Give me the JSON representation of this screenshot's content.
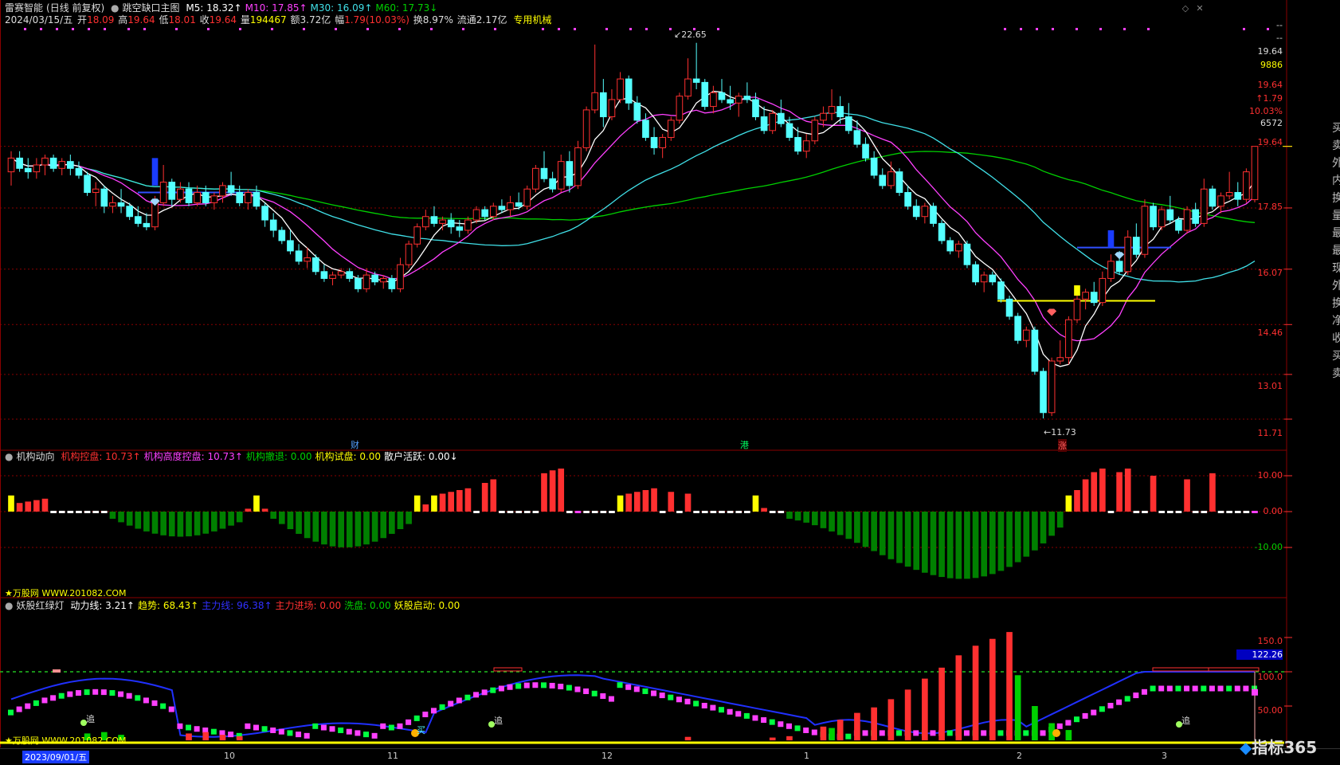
{
  "window": {
    "title": "雷赛智能",
    "period": "(日线 前复权)",
    "indicator": "跳空缺口主图",
    "controls": [
      "◇",
      "✕"
    ]
  },
  "ma_legend": [
    {
      "name": "M5",
      "value": "18.32",
      "arrow": "↑",
      "color": "#ffffff"
    },
    {
      "name": "M10",
      "value": "17.85",
      "arrow": "↑",
      "color": "#ff40ff"
    },
    {
      "name": "M30",
      "value": "16.09",
      "arrow": "↑",
      "color": "#40e0e8"
    },
    {
      "name": "M60",
      "value": "17.73",
      "arrow": "↓",
      "color": "#00d000"
    }
  ],
  "quote": {
    "date": "2024/03/15/五",
    "open_label": "开",
    "open": "18.09",
    "high_label": "高",
    "high": "19.64",
    "low_label": "低",
    "low": "18.01",
    "close_label": "收",
    "close": "19.64",
    "vol_label": "量",
    "vol": "194467",
    "amt_label": "额",
    "amt": "3.72亿",
    "chg_label": "幅",
    "chg": "1.79(10.03%)",
    "turnover_label": "换",
    "turnover": "8.97%",
    "float_label": "流通",
    "float": "2.17亿",
    "sector": "专用机械"
  },
  "price_axis": [
    "19.64",
    "17.85",
    "16.07",
    "14.46",
    "13.01",
    "11.71"
  ],
  "price_annotations": {
    "high": "22.65",
    "low": "11.73"
  },
  "markers": {
    "cai": "财",
    "gang": "港",
    "zhang": "涨",
    "zhui": "追",
    "mai": "买"
  },
  "right_info": {
    "dash1": "--",
    "dash2": "--",
    "price_a": "19.64",
    "vol_a": "9886",
    "price_b": "19.64",
    "chg_up": "↑1.79",
    "chg_pct": "10.03%",
    "vol_b": "6572"
  },
  "right_side_text": [
    "买",
    "卖",
    "外",
    "内",
    "换",
    "量",
    "最",
    "最",
    "现",
    "外",
    "换",
    "净",
    "收",
    "买",
    "卖"
  ],
  "inst_legend": {
    "title": "机构动向",
    "items": [
      {
        "label": "机构控盘:",
        "value": "10.73",
        "arrow": "↑",
        "color": "#ff3030"
      },
      {
        "label": "机构高度控盘:",
        "value": "10.73",
        "arrow": "↑",
        "color": "#ff40ff"
      },
      {
        "label": "机构撤退:",
        "value": "0.00",
        "arrow": "",
        "color": "#00d000"
      },
      {
        "label": "机构试盘:",
        "value": "0.00",
        "arrow": "",
        "color": "#ffff00"
      },
      {
        "label": "散户活跃:",
        "value": "0.00",
        "arrow": "↓",
        "color": "#ffffff"
      }
    ],
    "axis": [
      "10.00",
      "0.00",
      "-10.00"
    ],
    "watermark": "★万股网 WWW.201082.COM"
  },
  "demon_legend": {
    "title": "妖股红绿灯",
    "items": [
      {
        "label": "动力线:",
        "value": "3.21",
        "arrow": "↑",
        "color": "#ffffff"
      },
      {
        "label": "趋势:",
        "value": "68.43",
        "arrow": "↑",
        "color": "#ffff00"
      },
      {
        "label": "主力线:",
        "value": "96.38",
        "arrow": "↑",
        "color": "#3030ff"
      },
      {
        "label": "主力进场:",
        "value": "0.00",
        "arrow": "",
        "color": "#ff3030"
      },
      {
        "label": "洗盘:",
        "value": "0.00",
        "arrow": "",
        "color": "#00d000"
      },
      {
        "label": "妖股启动:",
        "value": "0.00",
        "arrow": "",
        "color": "#ffff00"
      }
    ],
    "axis": [
      "150.0",
      "122.26",
      "100.0",
      "50.00"
    ],
    "watermark": "★万股网 WWW.201082.COM"
  },
  "time_axis": {
    "start": "2023/09/01/五",
    "months": [
      "10",
      "11",
      "12",
      "1",
      "2",
      "3"
    ]
  },
  "logo": "指标365",
  "colors": {
    "up": "#ff3030",
    "down": "#54ffff",
    "grid": "#8a0000"
  },
  "chart_data": {
    "type": "candlestick",
    "title": "跳空缺口主图",
    "ylim": [
      11.2,
      23.2
    ],
    "x_start": "2023/09/01",
    "candles": [
      [
        18.9,
        19.5,
        18.5,
        19.3
      ],
      [
        19.3,
        19.5,
        18.9,
        19.0
      ],
      [
        19.0,
        19.3,
        18.7,
        18.9
      ],
      [
        18.9,
        19.3,
        18.7,
        19.1
      ],
      [
        19.1,
        19.4,
        18.8,
        19.3
      ],
      [
        19.3,
        19.4,
        18.9,
        19.0
      ],
      [
        19.0,
        19.3,
        18.8,
        19.2
      ],
      [
        19.2,
        19.4,
        18.8,
        19.0
      ],
      [
        19.0,
        19.2,
        18.7,
        18.8
      ],
      [
        18.8,
        18.9,
        18.2,
        18.3
      ],
      [
        18.3,
        18.6,
        17.9,
        18.4
      ],
      [
        18.4,
        18.5,
        17.7,
        17.9
      ],
      [
        17.9,
        18.2,
        17.7,
        18.0
      ],
      [
        18.0,
        18.4,
        17.7,
        17.9
      ],
      [
        17.9,
        18.0,
        17.5,
        17.6
      ],
      [
        17.6,
        17.9,
        17.3,
        17.4
      ],
      [
        17.4,
        17.7,
        17.2,
        17.3
      ],
      [
        17.3,
        18.2,
        17.2,
        18.0
      ],
      [
        18.0,
        19.1,
        17.9,
        18.6
      ],
      [
        18.6,
        18.7,
        17.9,
        18.1
      ],
      [
        18.1,
        18.6,
        18.0,
        18.4
      ],
      [
        18.4,
        18.6,
        17.9,
        18.0
      ],
      [
        18.0,
        18.5,
        17.9,
        18.3
      ],
      [
        18.3,
        18.5,
        17.9,
        18.0
      ],
      [
        18.0,
        18.3,
        17.8,
        18.2
      ],
      [
        18.2,
        18.6,
        18.0,
        18.5
      ],
      [
        18.5,
        18.9,
        18.2,
        18.3
      ],
      [
        18.3,
        18.5,
        17.9,
        18.0
      ],
      [
        18.0,
        18.4,
        17.8,
        18.3
      ],
      [
        18.3,
        18.5,
        17.8,
        17.9
      ],
      [
        17.9,
        18.0,
        17.3,
        17.5
      ],
      [
        17.5,
        17.7,
        17.0,
        17.2
      ],
      [
        17.2,
        17.3,
        16.8,
        16.9
      ],
      [
        16.9,
        17.2,
        16.5,
        16.6
      ],
      [
        16.6,
        16.8,
        16.2,
        16.3
      ],
      [
        16.3,
        16.7,
        16.1,
        16.4
      ],
      [
        16.4,
        16.5,
        15.9,
        16.0
      ],
      [
        16.0,
        16.2,
        15.7,
        15.8
      ],
      [
        15.8,
        16.0,
        15.6,
        15.9
      ],
      [
        15.9,
        16.1,
        15.8,
        16.0
      ],
      [
        16.0,
        16.1,
        15.7,
        15.8
      ],
      [
        15.8,
        15.9,
        15.4,
        15.5
      ],
      [
        15.5,
        16.1,
        15.4,
        15.9
      ],
      [
        15.9,
        16.0,
        15.6,
        15.7
      ],
      [
        15.7,
        15.9,
        15.5,
        15.8
      ],
      [
        15.8,
        15.9,
        15.4,
        15.5
      ],
      [
        15.5,
        16.4,
        15.4,
        16.2
      ],
      [
        16.2,
        16.9,
        16.1,
        16.8
      ],
      [
        16.8,
        17.4,
        16.7,
        17.3
      ],
      [
        17.3,
        17.8,
        17.2,
        17.6
      ],
      [
        17.6,
        17.9,
        17.3,
        17.4
      ],
      [
        17.4,
        17.6,
        17.2,
        17.5
      ],
      [
        17.5,
        17.7,
        17.1,
        17.3
      ],
      [
        17.3,
        17.5,
        17.0,
        17.2
      ],
      [
        17.2,
        17.6,
        17.1,
        17.5
      ],
      [
        17.5,
        17.9,
        17.4,
        17.8
      ],
      [
        17.8,
        17.9,
        17.5,
        17.6
      ],
      [
        17.6,
        18.0,
        17.5,
        17.9
      ],
      [
        17.9,
        18.1,
        17.7,
        17.8
      ],
      [
        17.8,
        18.2,
        17.6,
        18.0
      ],
      [
        18.0,
        18.3,
        17.8,
        17.9
      ],
      [
        17.9,
        18.5,
        17.8,
        18.4
      ],
      [
        18.4,
        19.1,
        18.3,
        19.0
      ],
      [
        19.0,
        19.5,
        18.6,
        18.7
      ],
      [
        18.7,
        18.9,
        18.3,
        18.4
      ],
      [
        18.4,
        19.4,
        18.3,
        19.2
      ],
      [
        19.2,
        19.5,
        18.3,
        18.5
      ],
      [
        18.5,
        19.8,
        18.4,
        19.6
      ],
      [
        19.6,
        20.8,
        19.5,
        20.7
      ],
      [
        20.7,
        22.6,
        20.6,
        21.2
      ],
      [
        21.2,
        21.6,
        20.2,
        20.5
      ],
      [
        20.5,
        21.3,
        20.4,
        21.0
      ],
      [
        21.0,
        21.8,
        20.9,
        21.6
      ],
      [
        21.6,
        21.7,
        20.7,
        20.9
      ],
      [
        20.9,
        21.1,
        20.3,
        20.4
      ],
      [
        20.4,
        20.6,
        19.8,
        19.9
      ],
      [
        19.9,
        20.2,
        19.4,
        19.6
      ],
      [
        19.6,
        20.0,
        19.3,
        19.9
      ],
      [
        19.9,
        20.5,
        19.8,
        20.4
      ],
      [
        20.4,
        21.2,
        20.3,
        21.1
      ],
      [
        21.1,
        22.2,
        21.0,
        21.6
      ],
      [
        21.6,
        22.65,
        21.3,
        21.5
      ],
      [
        21.5,
        21.6,
        20.7,
        20.8
      ],
      [
        20.8,
        21.4,
        20.6,
        21.2
      ],
      [
        21.2,
        21.6,
        20.9,
        21.0
      ],
      [
        21.0,
        21.4,
        20.7,
        20.9
      ],
      [
        20.9,
        21.2,
        20.5,
        21.1
      ],
      [
        21.1,
        21.5,
        20.9,
        21.0
      ],
      [
        21.0,
        21.2,
        20.4,
        20.5
      ],
      [
        20.5,
        20.8,
        20.0,
        20.1
      ],
      [
        20.1,
        20.7,
        20.0,
        20.6
      ],
      [
        20.6,
        21.0,
        20.2,
        20.3
      ],
      [
        20.3,
        20.5,
        19.8,
        19.9
      ],
      [
        19.9,
        20.2,
        19.4,
        19.5
      ],
      [
        19.5,
        20.0,
        19.3,
        19.8
      ],
      [
        19.8,
        20.5,
        19.7,
        20.4
      ],
      [
        20.4,
        20.8,
        20.2,
        20.6
      ],
      [
        20.6,
        21.3,
        20.4,
        20.8
      ],
      [
        20.8,
        21.1,
        20.3,
        20.5
      ],
      [
        20.5,
        20.9,
        20.0,
        20.1
      ],
      [
        20.1,
        20.4,
        19.6,
        19.7
      ],
      [
        19.7,
        19.9,
        19.2,
        19.3
      ],
      [
        19.3,
        19.5,
        18.7,
        18.8
      ],
      [
        18.8,
        19.0,
        18.4,
        18.5
      ],
      [
        18.5,
        19.2,
        18.4,
        18.9
      ],
      [
        18.9,
        19.0,
        18.2,
        18.3
      ],
      [
        18.3,
        18.5,
        17.8,
        17.9
      ],
      [
        17.9,
        18.1,
        17.5,
        17.6
      ],
      [
        17.6,
        18.0,
        17.4,
        17.9
      ],
      [
        17.9,
        18.0,
        17.3,
        17.4
      ],
      [
        17.4,
        17.5,
        16.8,
        16.9
      ],
      [
        16.9,
        17.0,
        16.5,
        16.6
      ],
      [
        16.6,
        16.9,
        16.4,
        16.8
      ],
      [
        16.8,
        16.9,
        16.1,
        16.2
      ],
      [
        16.2,
        16.3,
        15.6,
        15.7
      ],
      [
        15.7,
        16.0,
        15.4,
        15.9
      ],
      [
        15.9,
        16.0,
        15.6,
        15.7
      ],
      [
        15.7,
        15.8,
        15.1,
        15.2
      ],
      [
        15.2,
        15.3,
        14.6,
        14.7
      ],
      [
        14.7,
        14.8,
        13.9,
        14.0
      ],
      [
        14.0,
        14.4,
        13.8,
        14.3
      ],
      [
        14.3,
        14.4,
        13.0,
        13.1
      ],
      [
        13.1,
        13.2,
        11.73,
        11.9
      ],
      [
        11.9,
        13.5,
        11.8,
        13.4
      ],
      [
        13.4,
        14.0,
        13.3,
        13.5
      ],
      [
        13.5,
        14.7,
        13.3,
        14.6
      ],
      [
        14.6,
        15.6,
        14.5,
        15.2
      ],
      [
        15.2,
        15.5,
        14.9,
        15.4
      ],
      [
        15.4,
        15.7,
        15.0,
        15.1
      ],
      [
        15.1,
        16.0,
        15.0,
        15.8
      ],
      [
        15.8,
        16.5,
        15.7,
        16.3
      ],
      [
        16.3,
        16.6,
        15.9,
        16.0
      ],
      [
        16.0,
        17.2,
        15.9,
        17.0
      ],
      [
        17.0,
        17.4,
        16.4,
        16.5
      ],
      [
        16.5,
        18.1,
        16.4,
        17.9
      ],
      [
        17.9,
        18.0,
        17.2,
        17.3
      ],
      [
        17.3,
        17.9,
        17.2,
        17.8
      ],
      [
        17.8,
        18.2,
        17.4,
        17.5
      ],
      [
        17.5,
        17.6,
        17.1,
        17.2
      ],
      [
        17.2,
        17.9,
        17.1,
        17.8
      ],
      [
        17.8,
        18.0,
        17.3,
        17.4
      ],
      [
        17.4,
        18.7,
        17.3,
        18.4
      ],
      [
        18.4,
        18.5,
        17.8,
        17.9
      ],
      [
        17.9,
        18.3,
        17.7,
        18.2
      ],
      [
        18.2,
        18.9,
        18.1,
        18.3
      ],
      [
        18.3,
        18.6,
        17.9,
        18.1
      ],
      [
        18.1,
        19.0,
        18.0,
        18.9
      ],
      [
        18.09,
        19.64,
        18.01,
        19.64
      ]
    ]
  }
}
